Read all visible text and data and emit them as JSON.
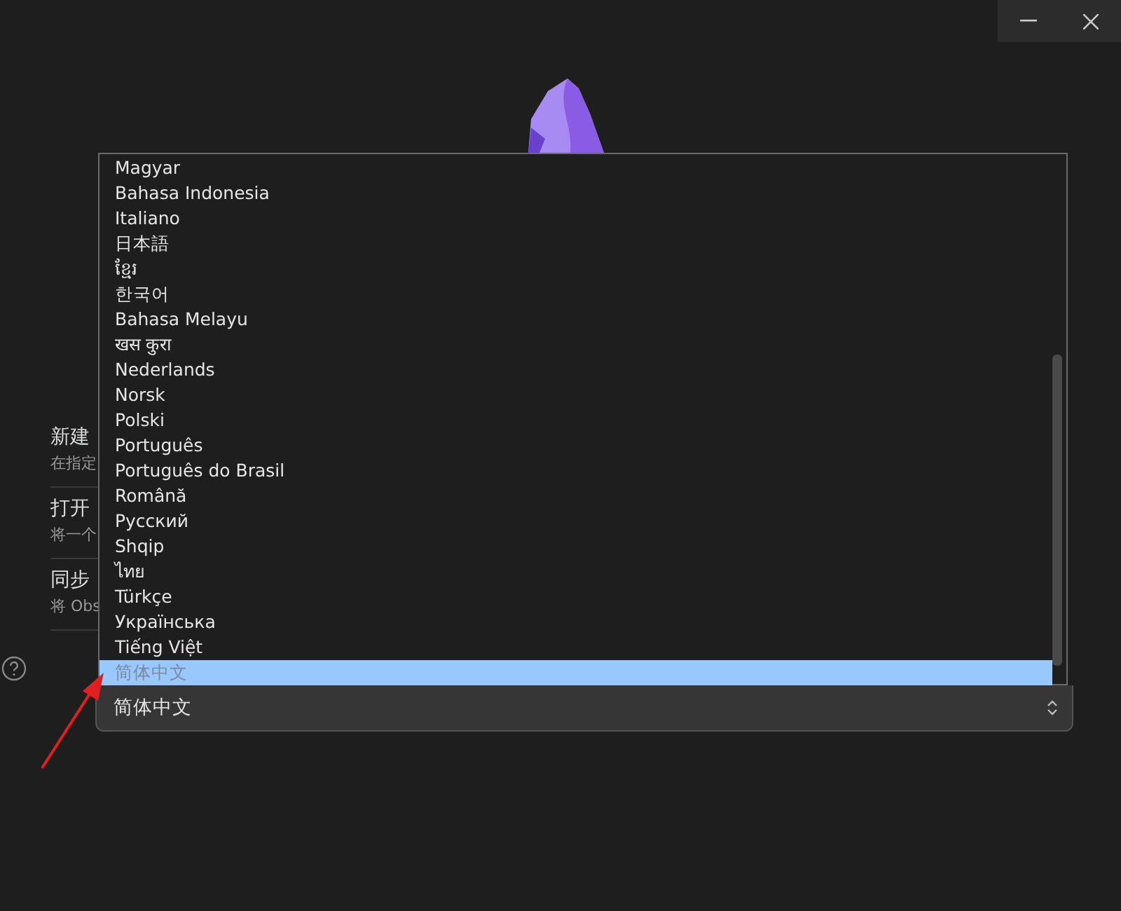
{
  "settings": [
    {
      "title": "新建",
      "description": "在指定"
    },
    {
      "title": "打开",
      "description": "将一个"
    },
    {
      "title": "同步",
      "description": "将 Obs"
    }
  ],
  "language_select": {
    "value": "简体中文",
    "options": [
      {
        "label": "Magyar",
        "selected": false
      },
      {
        "label": "Bahasa Indonesia",
        "selected": false
      },
      {
        "label": "Italiano",
        "selected": false
      },
      {
        "label": "日本語",
        "selected": false
      },
      {
        "label": "ខ្មែរ",
        "selected": false
      },
      {
        "label": "한국어",
        "selected": false
      },
      {
        "label": "Bahasa Melayu",
        "selected": false
      },
      {
        "label": "खस कुरा",
        "selected": false
      },
      {
        "label": "Nederlands",
        "selected": false
      },
      {
        "label": "Norsk",
        "selected": false
      },
      {
        "label": "Polski",
        "selected": false
      },
      {
        "label": "Português",
        "selected": false
      },
      {
        "label": "Português do Brasil",
        "selected": false
      },
      {
        "label": "Română",
        "selected": false
      },
      {
        "label": "Русский",
        "selected": false
      },
      {
        "label": "Shqip",
        "selected": false
      },
      {
        "label": "ไทย",
        "selected": false
      },
      {
        "label": "Türkçe",
        "selected": false
      },
      {
        "label": "Українська",
        "selected": false
      },
      {
        "label": "Tiếng Việt",
        "selected": false
      },
      {
        "label": "简体中文",
        "selected": true
      }
    ]
  }
}
